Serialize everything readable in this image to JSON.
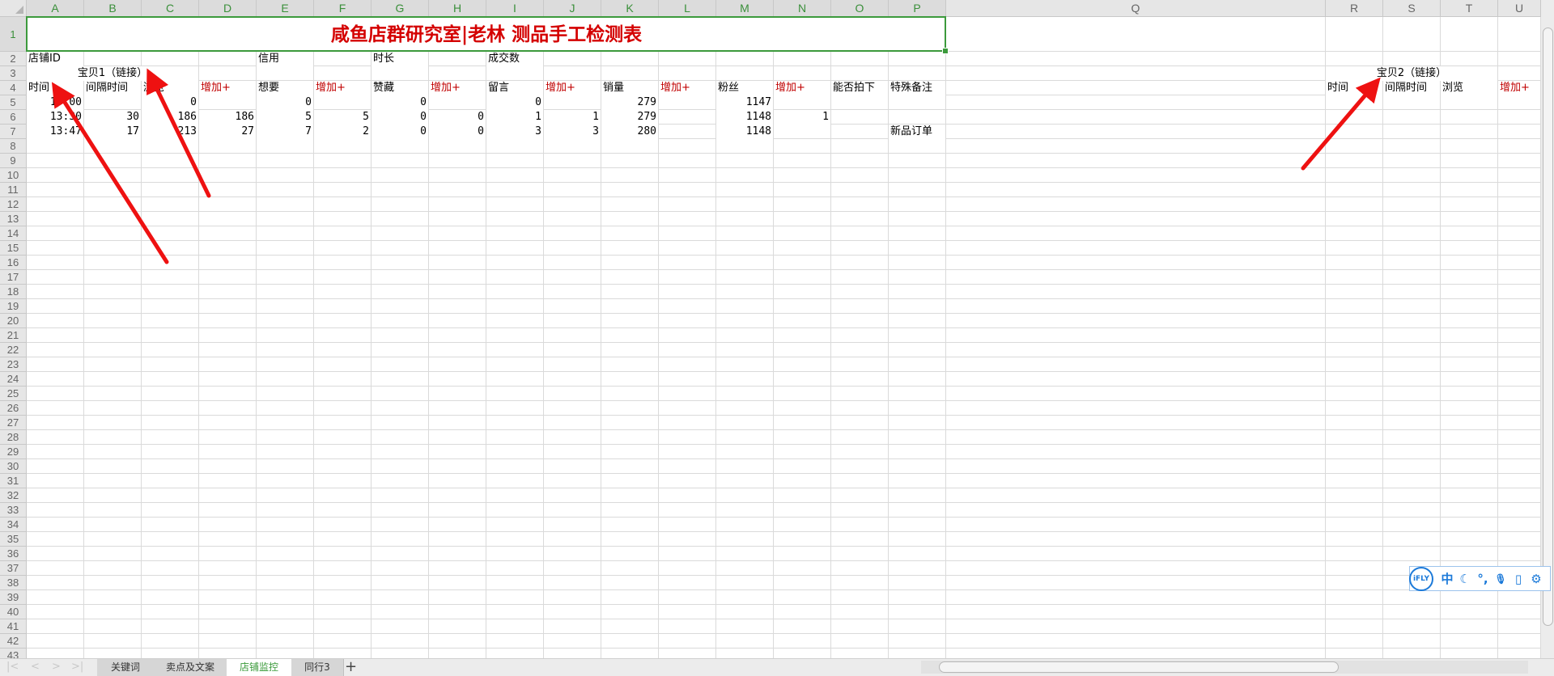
{
  "sheet": {
    "columns": [
      "A",
      "B",
      "C",
      "D",
      "E",
      "F",
      "G",
      "H",
      "I",
      "J",
      "K",
      "L",
      "M",
      "N",
      "O",
      "P",
      "Q",
      "R",
      "S",
      "T",
      "U"
    ],
    "selected_columns": [
      "A",
      "B",
      "C",
      "D",
      "E",
      "F",
      "G",
      "H",
      "I",
      "J",
      "K",
      "L",
      "M",
      "N",
      "O",
      "P"
    ],
    "row_count": 43,
    "title": "咸鱼店群研究室|老林  测品手工检测表",
    "cells": {
      "A2": "店铺ID",
      "E2": "信用",
      "G2": "时长",
      "I2": "成交数",
      "A3": "宝贝1（链接）",
      "R3": "宝贝2（链接）",
      "A4": "时间",
      "B4": "间隔时间",
      "C4": "浏览",
      "D4": "增加+",
      "E4": "想要",
      "F4": "增加+",
      "G4": "赞藏",
      "H4": "增加+",
      "I4": "留言",
      "J4": "增加+",
      "K4": "销量",
      "L4": "增加+",
      "M4": "粉丝",
      "N4": "增加+",
      "O4": "能否拍下",
      "P4": "特殊备注",
      "R4": "时间",
      "S4": "间隔时间",
      "T4": "浏览",
      "U4": "增加+",
      "A5": "13:00",
      "C5": "0",
      "E5": "0",
      "G5": "0",
      "I5": "0",
      "K5": "279",
      "M5": "1147",
      "A6": "13:30",
      "B6": "30",
      "C6": "186",
      "D6": "186",
      "E6": "5",
      "F6": "5",
      "G6": "0",
      "H6": "0",
      "I6": "1",
      "J6": "1",
      "K6": "279",
      "M6": "1148",
      "N6": "1",
      "A7": "13:47",
      "B7": "17",
      "C7": "213",
      "D7": "27",
      "E7": "7",
      "F7": "2",
      "G7": "0",
      "H7": "0",
      "I7": "3",
      "J7": "3",
      "K7": "280",
      "M7": "1148",
      "P7": "新品订单"
    },
    "merged_centered": {
      "A3": "C",
      "R3": "T"
    },
    "highlight_cells": [
      "D4",
      "F4",
      "H4",
      "J4",
      "L4",
      "N4",
      "U4"
    ],
    "highlight_color": "#c00000",
    "title_color": "#d40000",
    "selection_color": "#3c9a3c"
  },
  "tabs": [
    {
      "label": "关键词",
      "active": false
    },
    {
      "label": "卖点及文案",
      "active": false
    },
    {
      "label": "店铺监控",
      "active": true
    },
    {
      "label": "同行3",
      "active": false
    }
  ],
  "add_tab_label": "+",
  "ime_toolbar": {
    "logo": "iFLY",
    "items": [
      {
        "icon": "chinese-mode-icon",
        "glyph": "中"
      },
      {
        "icon": "moon-icon",
        "glyph": "☾"
      },
      {
        "icon": "punctuation-icon",
        "glyph": "°,"
      },
      {
        "icon": "microphone-icon",
        "glyph": "🎙"
      },
      {
        "icon": "tablet-icon",
        "glyph": "▯"
      },
      {
        "icon": "gear-icon",
        "glyph": "⚙"
      }
    ]
  },
  "annotation_color": "#ee1111"
}
